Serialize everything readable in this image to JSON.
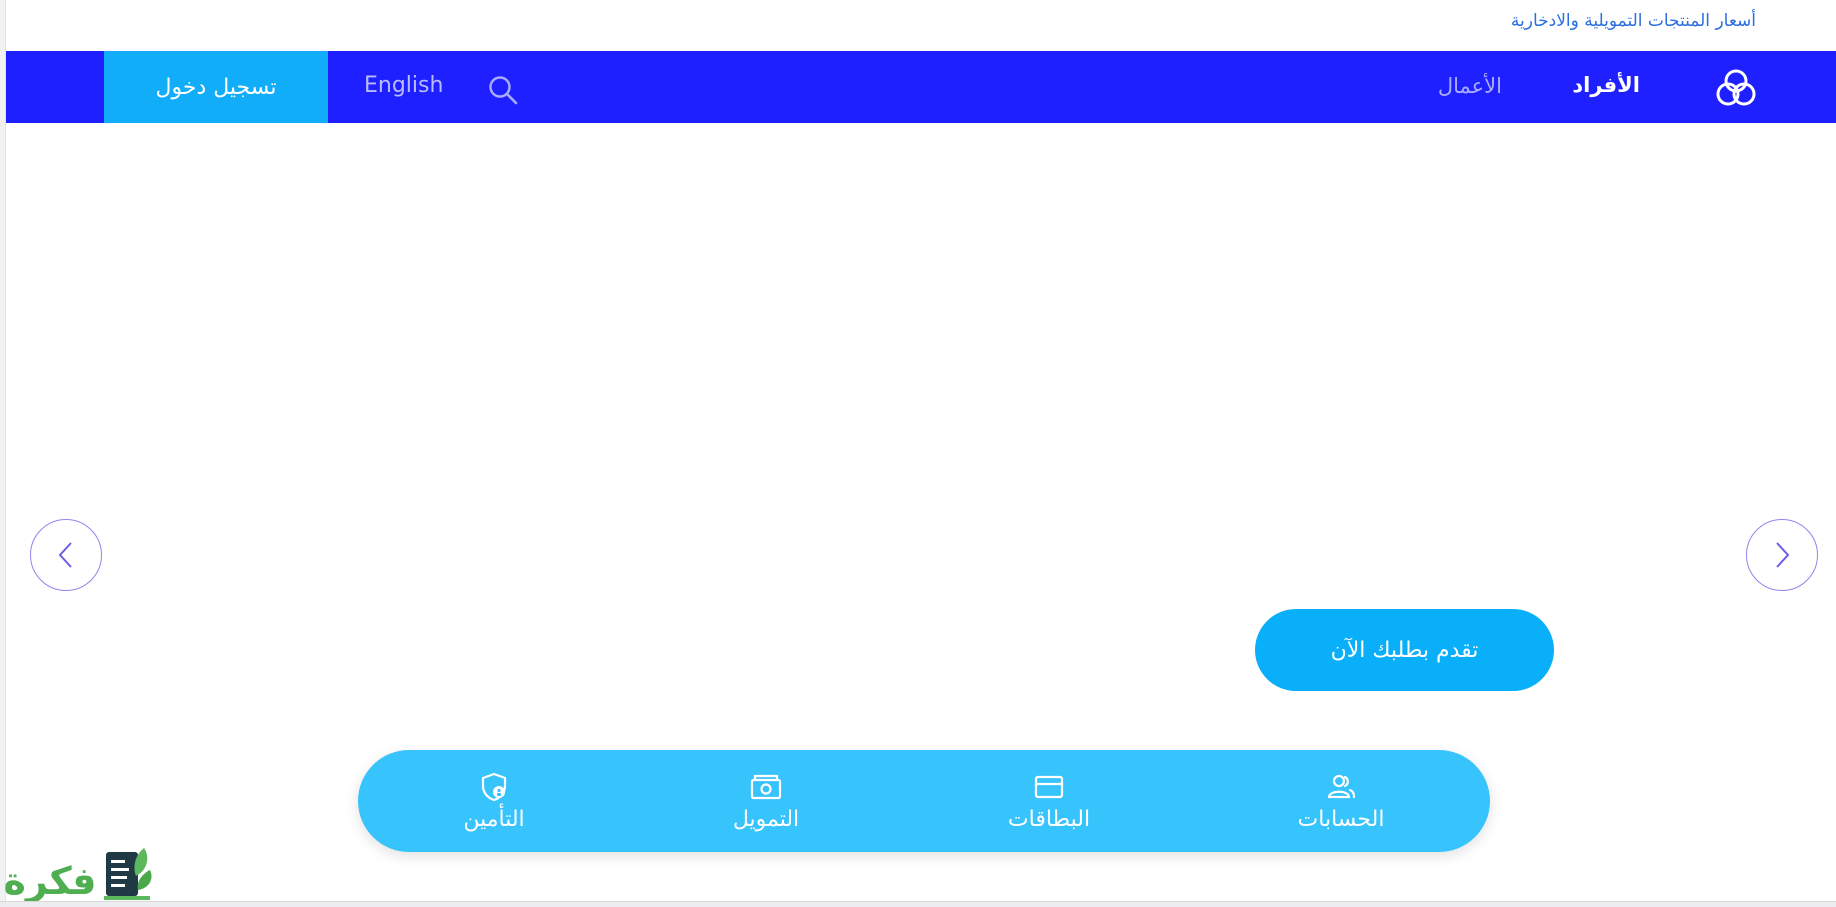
{
  "header": {
    "top_link": "أسعار المنتجات التمويلية والادخارية"
  },
  "navbar": {
    "individuals": "الأفراد",
    "business": "الأعمال",
    "language": "English",
    "login": "تسجيل دخول"
  },
  "hero": {
    "apply_button": "تقدم بطلبك الآن"
  },
  "quick_links": {
    "accounts": "الحسابات",
    "cards": "البطاقات",
    "finance": "التمويل",
    "insurance": "التأمين"
  },
  "colors": {
    "navbar": "#1e20ff",
    "login_button": "#12adf9",
    "quick_bar": "#37c3fb",
    "apply_button": "#0aaff9",
    "top_link": "#2a6fe0"
  },
  "icons": {
    "logo": "bank-logo-icon",
    "search": "search-icon",
    "carousel_prev": "chevron-left-icon",
    "carousel_next": "chevron-right-icon",
    "accounts": "user-group-icon",
    "cards": "credit-card-icon",
    "finance": "banknote-icon",
    "insurance": "shield-user-icon"
  },
  "watermark": {
    "text": "فكرة"
  }
}
